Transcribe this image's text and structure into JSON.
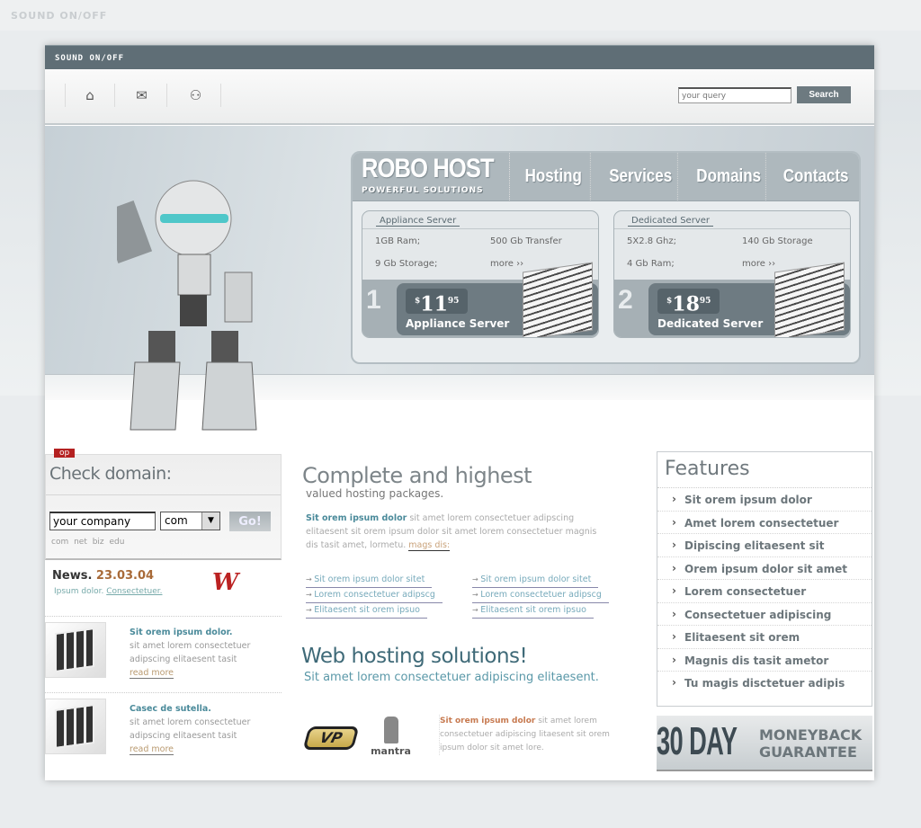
{
  "top_bar": {
    "sound_toggle": "SOUND ON/OFF"
  },
  "nav_icons": [
    "home-icon",
    "mail-icon",
    "sitemap-icon"
  ],
  "search": {
    "placeholder": "your query",
    "button": "Search"
  },
  "brand": {
    "name": "ROBO HOST",
    "tagline": "POWERFUL SOLUTIONS"
  },
  "menu": [
    "Hosting",
    "Services",
    "Domains",
    "Contacts"
  ],
  "plans": [
    {
      "title": "Appliance Server",
      "specs": [
        "1GB Ram;",
        "500 Gb Transfer",
        "9 Gb Storage;",
        "more ››"
      ],
      "number": "1",
      "price": "11",
      "cents": "95",
      "currency": "$",
      "name": "Appliance Server"
    },
    {
      "title": "Dedicated Server",
      "specs": [
        "5X2.8 Ghz;",
        "140 Gb Storage",
        "4 Gb Ram;",
        "more ››"
      ],
      "number": "2",
      "price": "18",
      "cents": "95",
      "currency": "$",
      "name": "Dedicated Server"
    }
  ],
  "domain": {
    "badge": "op",
    "title": "Check domain:",
    "value": "your company",
    "tld": "com",
    "go": "Go!",
    "tlds": "com net biz edu"
  },
  "news": {
    "label": "News.",
    "date": "23.03.04",
    "text": "Ipsum dolor.",
    "link": "Consectetuer."
  },
  "news_items": [
    {
      "title": "Sit orem ipsum dolor.",
      "text": "sit amet lorem consectetuer adipscing elitaesent tasit",
      "link": "read more"
    },
    {
      "title": "Casec de sutella.",
      "text": "sit amet lorem consectetuer adipscing elitaesent tasit",
      "link": "read more"
    }
  ],
  "intro": {
    "title": "Complete and highest",
    "subtitle": "valued hosting packages.",
    "lead": "Sit orem ipsum dolor",
    "body": " sit amet lorem consectetuer adipscing elitaesent sit orem ipsum dolor sit amet lorem consectetuer magnis dis tasit amet, lormetu. ",
    "link": "mags dis:"
  },
  "links_col1": [
    "Sit orem ipsum dolor sitet",
    "Lorem consectetuer adipscg",
    "Elitaesent sit orem ipsuo"
  ],
  "links_col2": [
    "Sit orem ipsum dolor sitet",
    "Lorem consectetuer adipscg",
    "Elitaesent sit orem ipsuo"
  ],
  "solutions": {
    "title": "Web hosting solutions!",
    "subtitle": "Sit amet lorem consectetuer adipiscing elitaesent.",
    "lead": "Sit orem ipsum dolor",
    "body": " sit amet lorem consectetuer adipiscing litaesent sit orem ipsum dolor sit amet lore.",
    "partner2": "mantra"
  },
  "features": {
    "title": "Features",
    "items": [
      "Sit orem ipsum dolor",
      "Amet lorem consectetuer",
      "Dipiscing elitaesent sit",
      "Orem ipsum dolor sit amet",
      "Lorem consectetuer",
      "Consectetuer adipiscing",
      "Elitaesent sit orem",
      "Magnis dis tasit ametor",
      "Tu magis disctetuer adipis"
    ]
  },
  "guarantee": {
    "big": "30 DAY",
    "line1": "MONEYBACK",
    "line2": "GUARANTEE"
  }
}
